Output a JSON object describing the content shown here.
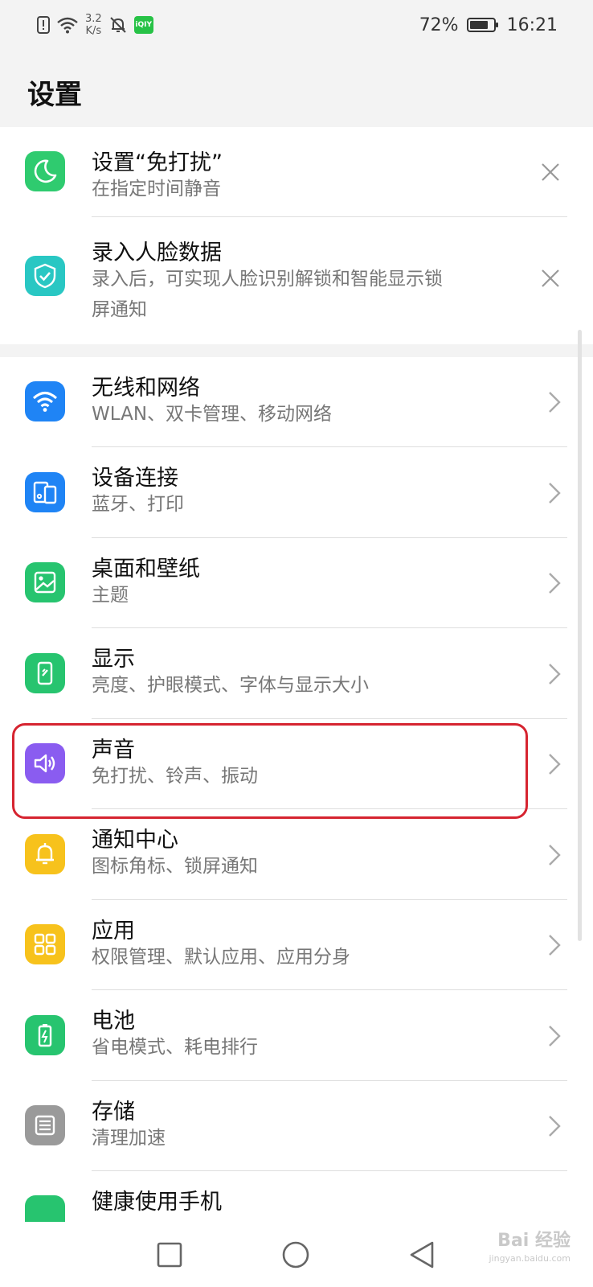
{
  "status_bar": {
    "net_speed_value": "3.2",
    "net_speed_unit": "K/s",
    "app_badge": "iQIY",
    "battery": "72%",
    "time": "16:21"
  },
  "header": {
    "title": "设置"
  },
  "suggestions": [
    {
      "title": "设置“免打扰”",
      "subtitle": "在指定时间静音",
      "icon": "moon-icon",
      "color": "#2fcb6f"
    },
    {
      "title": "录入人脸数据",
      "subtitle_line1": "录入后，可实现人脸识别解锁和智能显示锁",
      "subtitle_line2": "屏通知",
      "icon": "shield-check-icon",
      "color": "#29c7c3"
    }
  ],
  "settings": [
    {
      "title": "无线和网络",
      "subtitle": "WLAN、双卡管理、移动网络",
      "icon": "wifi-icon",
      "color": "#1f84f5"
    },
    {
      "title": "设备连接",
      "subtitle": "蓝牙、打印",
      "icon": "devices-icon",
      "color": "#1f84f5"
    },
    {
      "title": "桌面和壁纸",
      "subtitle": "主题",
      "icon": "wallpaper-icon",
      "color": "#27c46f"
    },
    {
      "title": "显示",
      "subtitle": "亮度、护眼模式、字体与显示大小",
      "icon": "display-icon",
      "color": "#27c46f"
    },
    {
      "title": "声音",
      "subtitle": "免打扰、铃声、振动",
      "icon": "speaker-icon",
      "color": "#8a5cf0"
    },
    {
      "title": "通知中心",
      "subtitle": "图标角标、锁屏通知",
      "icon": "bell-icon",
      "color": "#f7c21c"
    },
    {
      "title": "应用",
      "subtitle": "权限管理、默认应用、应用分身",
      "icon": "apps-grid-icon",
      "color": "#f7c21c"
    },
    {
      "title": "电池",
      "subtitle": "省电模式、耗电排行",
      "icon": "battery-icon",
      "color": "#27c46f"
    },
    {
      "title": "存储",
      "subtitle": "清理加速",
      "icon": "storage-icon",
      "color": "#9a9a9a"
    },
    {
      "title": "健康使用手机",
      "icon": "health-icon",
      "color": "#27c46f"
    }
  ],
  "watermark": {
    "brand": "Bai 经验",
    "url": "jingyan.baidu.com"
  }
}
